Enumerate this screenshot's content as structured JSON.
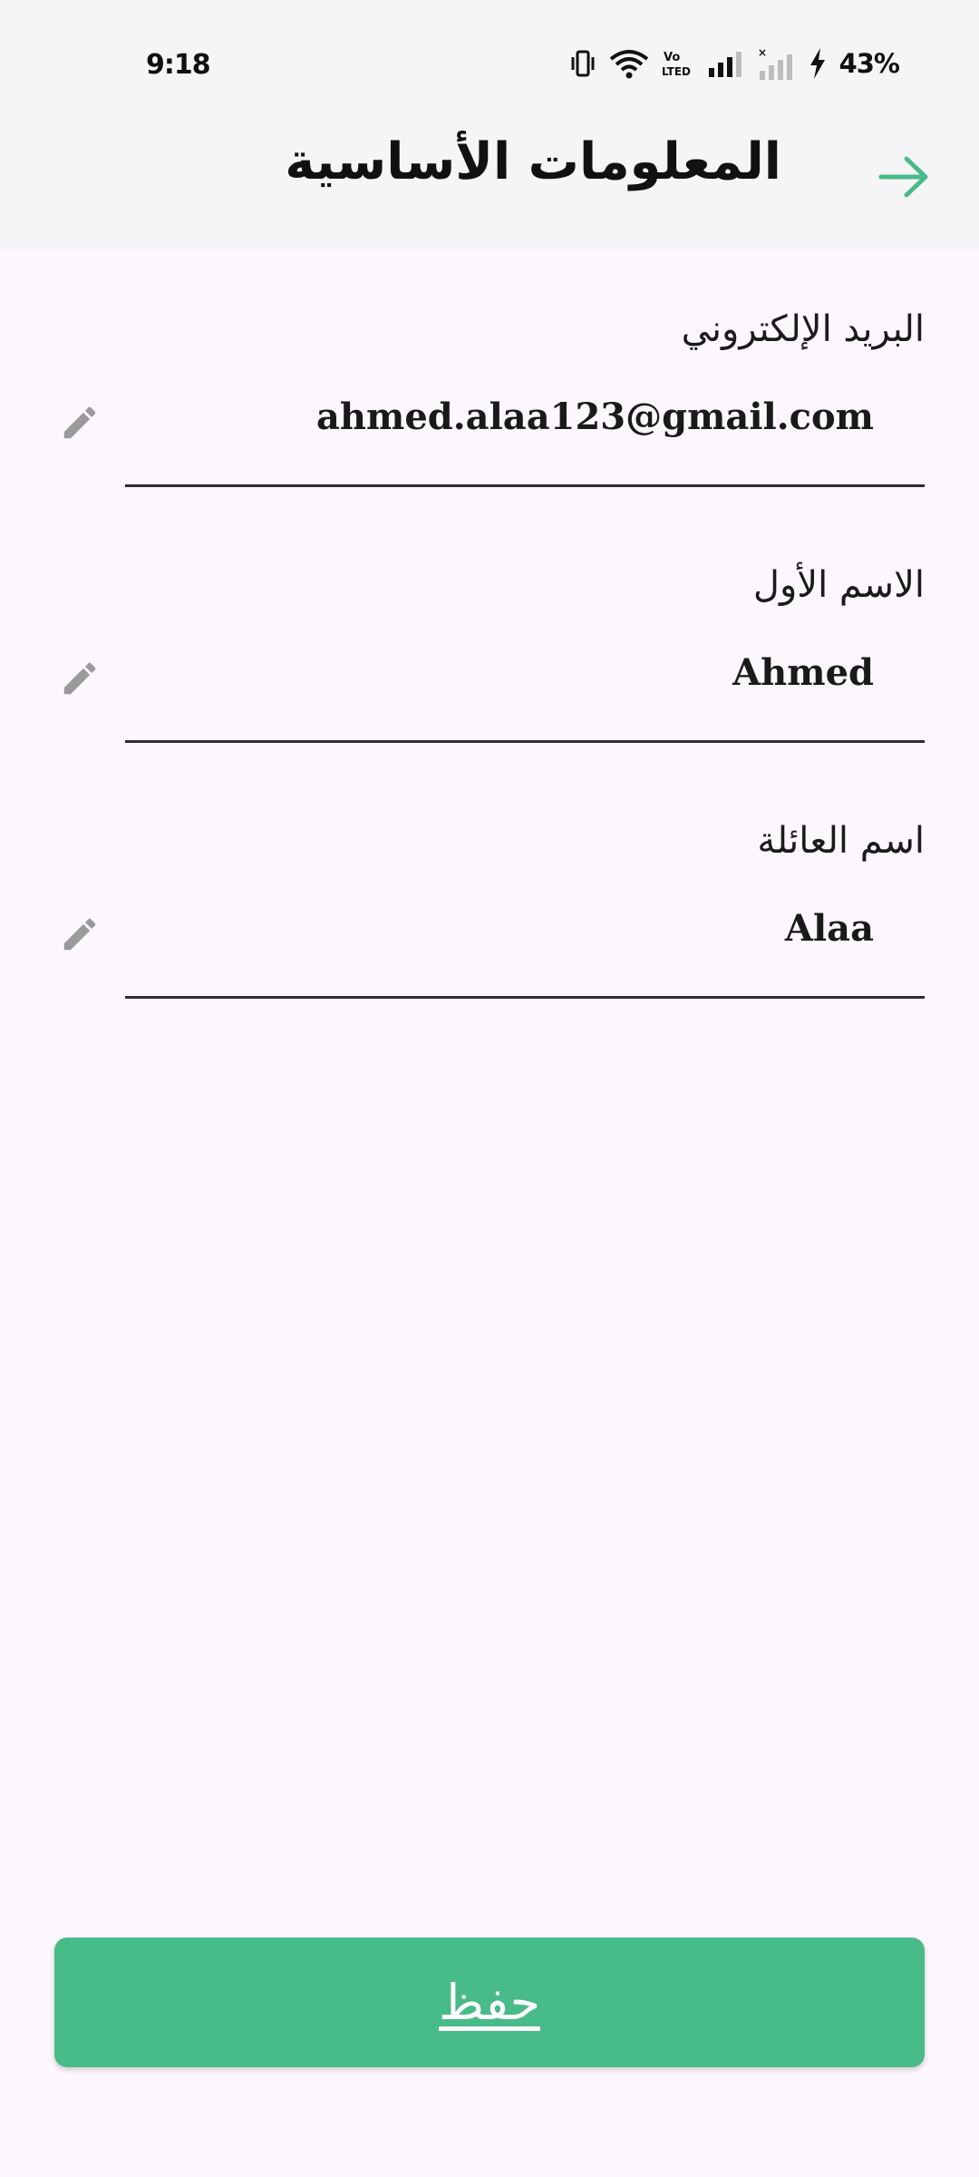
{
  "status_bar": {
    "time": "9:18",
    "battery": "43%",
    "icons": [
      "vibrate-icon",
      "wifi-icon",
      "volte-icon",
      "signal-icon",
      "signal-no-service-icon",
      "charging-icon"
    ]
  },
  "header": {
    "title": "المعلومات الأساسية",
    "back_icon": "arrow-right-icon",
    "accent_color": "#47bc89"
  },
  "fields": [
    {
      "label": "البريد الإلكتروني",
      "value": "ahmed.alaa123@gmail.com",
      "icon": "pencil-icon"
    },
    {
      "label": "الاسم الأول",
      "value": "Ahmed",
      "icon": "pencil-icon"
    },
    {
      "label": "اسم العائلة",
      "value": "Alaa",
      "icon": "pencil-icon"
    }
  ],
  "save_button": {
    "label": "حفظ",
    "color": "#47bc89"
  }
}
